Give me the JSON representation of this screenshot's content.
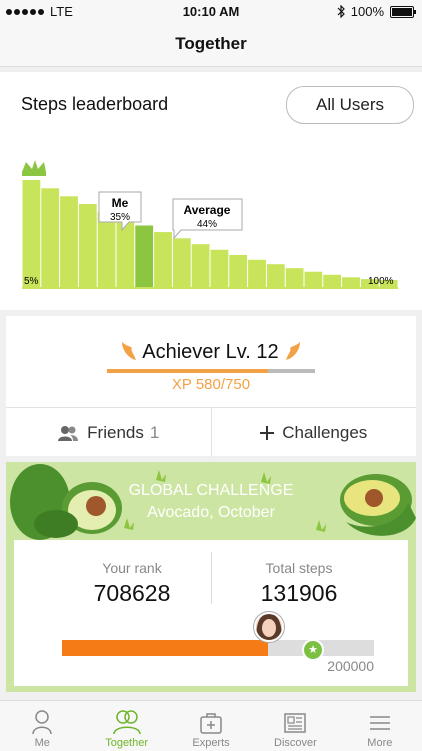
{
  "status": {
    "carrier": "LTE",
    "time": "10:10 AM",
    "battery": "100%"
  },
  "nav": {
    "title": "Together"
  },
  "leaderboard": {
    "title": "Steps leaderboard",
    "filter_label": "All Users",
    "me_label": "Me",
    "me_pct": "35%",
    "avg_label": "Average",
    "avg_pct": "44%",
    "low_label": "5%",
    "high_label": "100%"
  },
  "achiever": {
    "title": "Achiever Lv. 12",
    "xp_text": "XP 580/750",
    "xp_fraction": 0.773,
    "friends_label": "Friends",
    "friends_count": "1",
    "challenges_label": "Challenges"
  },
  "challenge": {
    "title": "GLOBAL CHALLENGE",
    "subtitle": "Avocado, October",
    "rank_label": "Your rank",
    "rank_value": "708628",
    "steps_label": "Total steps",
    "steps_value": "131906",
    "goal_value": "200000",
    "progress_fraction": 0.66
  },
  "tabs": [
    {
      "label": "Me"
    },
    {
      "label": "Together"
    },
    {
      "label": "Experts"
    },
    {
      "label": "Discover"
    },
    {
      "label": "More"
    }
  ],
  "colors": {
    "accent": "#6fb52c",
    "xp": "#f3a146",
    "progress": "#f57b17",
    "bar": "#c7e45a",
    "bar_me": "#8cc540"
  }
}
